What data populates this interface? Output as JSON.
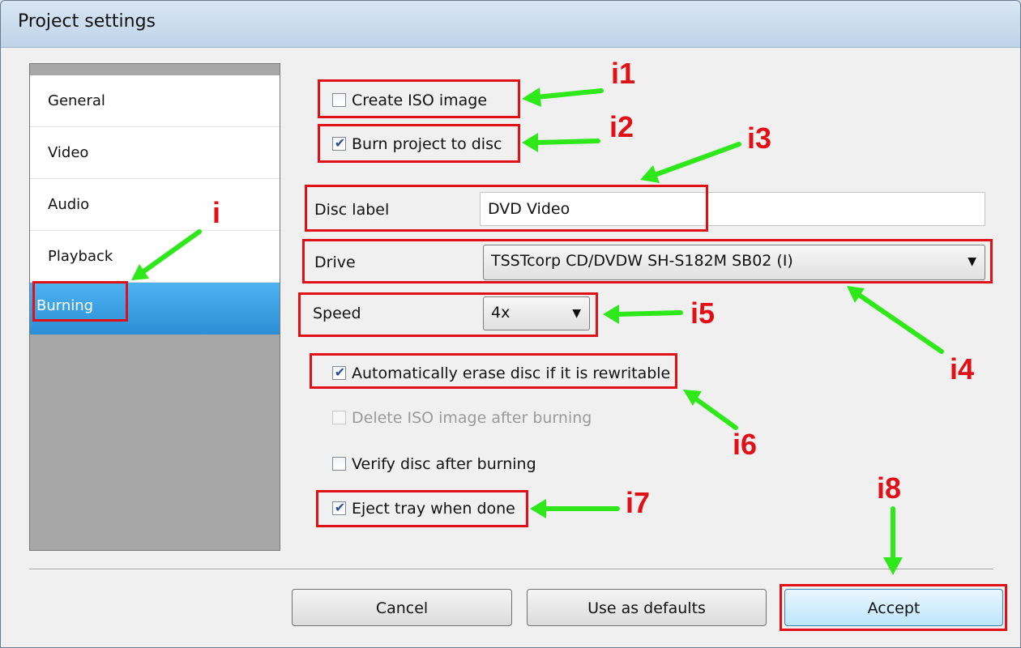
{
  "window": {
    "title": "Project settings"
  },
  "sidebar": {
    "items": [
      {
        "label": "General"
      },
      {
        "label": "Video"
      },
      {
        "label": "Audio"
      },
      {
        "label": "Playback"
      },
      {
        "label": "Burning",
        "selected": true
      }
    ]
  },
  "options": {
    "create_iso": {
      "label": "Create ISO image",
      "checked": false
    },
    "burn_project": {
      "label": "Burn project to disc",
      "checked": true
    },
    "auto_erase": {
      "label": "Automatically erase disc if it is rewritable",
      "checked": true
    },
    "delete_iso": {
      "label": "Delete ISO image after burning",
      "checked": false,
      "disabled": true
    },
    "verify_disc": {
      "label": "Verify disc after burning",
      "checked": false
    },
    "eject_tray": {
      "label": "Eject tray when done",
      "checked": true
    }
  },
  "disc_label": {
    "label": "Disc label",
    "value": "DVD Video"
  },
  "drive": {
    "label": "Drive",
    "value": "TSSTcorp CD/DVDW SH-S182M SB02 (I)"
  },
  "speed": {
    "label": "Speed",
    "value": "4x"
  },
  "buttons": {
    "cancel": "Cancel",
    "defaults": "Use as defaults",
    "accept": "Accept"
  },
  "annotations": {
    "labels": {
      "sidebar": "i",
      "iso": "i1",
      "burn": "i2",
      "disc_label": "i3",
      "drive": "i4",
      "speed": "i5",
      "erase": "i6",
      "eject": "i7",
      "accept": "i8"
    },
    "highlight_color": "#e01016",
    "arrow_color": "#2ee81a"
  },
  "icons": {
    "checkmark": "checkmark-icon",
    "dropdown": "chevron-down-icon"
  }
}
